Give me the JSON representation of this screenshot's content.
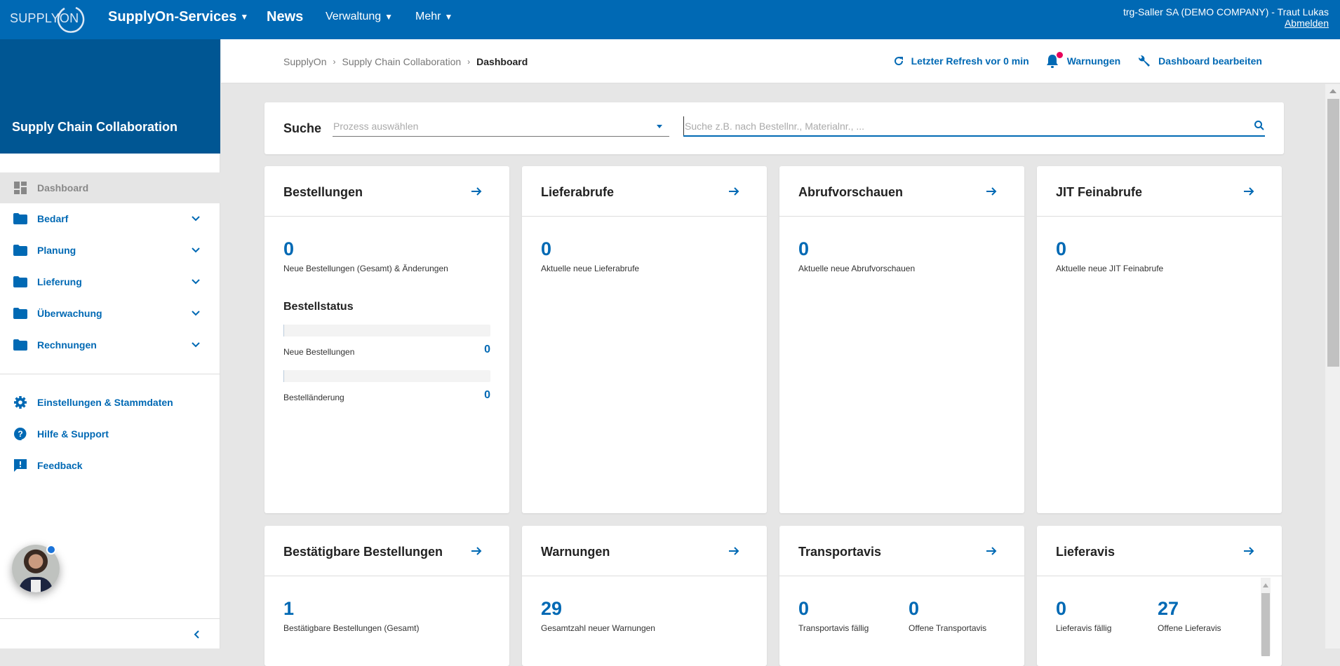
{
  "topbar": {
    "logo_text": "SUPPLYON",
    "nav": [
      {
        "label": "SupplyOn-Services",
        "has_caret": true
      },
      {
        "label": "News",
        "has_caret": false
      },
      {
        "label": "Verwaltung",
        "has_caret": true
      },
      {
        "label": "Mehr",
        "has_caret": true
      }
    ],
    "caret": "▼",
    "user": "trg-Saller SA (DEMO COMPANY) - Traut Lukas",
    "logout": "Abmelden"
  },
  "sidebar": {
    "title": "Supply Chain Collaboration",
    "items": [
      {
        "label": "Dashboard",
        "icon": "dashboard-icon",
        "active": true
      },
      {
        "label": "Bedarf",
        "icon": "folder-icon",
        "expandable": true
      },
      {
        "label": "Planung",
        "icon": "folder-icon",
        "expandable": true
      },
      {
        "label": "Lieferung",
        "icon": "folder-icon",
        "expandable": true
      },
      {
        "label": "Überwachung",
        "icon": "folder-icon",
        "expandable": true
      },
      {
        "label": "Rechnungen",
        "icon": "folder-icon",
        "expandable": true
      }
    ],
    "bottom_items": [
      {
        "label": "Einstellungen & Stammdaten",
        "icon": "gear-icon"
      },
      {
        "label": "Hilfe & Support",
        "icon": "help-icon"
      },
      {
        "label": "Feedback",
        "icon": "feedback-icon"
      }
    ]
  },
  "breadcrumb": {
    "items": [
      "SupplyOn",
      "Supply Chain Collaboration"
    ],
    "current": "Dashboard",
    "separator": "›"
  },
  "header_actions": {
    "refresh": "Letzter Refresh vor 0 min",
    "warnings": "Warnungen",
    "edit_dashboard": "Dashboard bearbeiten"
  },
  "search": {
    "label": "Suche",
    "process_placeholder": "Prozess auswählen",
    "query_placeholder": "Suche z.B. nach Bestellnr., Materialnr., ...",
    "query_value": ""
  },
  "tiles": {
    "bestellungen": {
      "title": "Bestellungen",
      "value": "0",
      "label": "Neue Bestellungen (Gesamt) & Änderungen",
      "status_title": "Bestellstatus",
      "status": [
        {
          "label": "Neue Bestellungen",
          "value": "0",
          "fraction": 0
        },
        {
          "label": "Bestelländerung",
          "value": "0",
          "fraction": 0
        }
      ]
    },
    "lieferabrufe": {
      "title": "Lieferabrufe",
      "value": "0",
      "label": "Aktuelle neue Lieferabrufe"
    },
    "abrufvorschauen": {
      "title": "Abrufvorschauen",
      "value": "0",
      "label": "Aktuelle neue Abrufvorschauen"
    },
    "jit": {
      "title": "JIT Feinabrufe",
      "value": "0",
      "label": "Aktuelle neue JIT Feinabrufe"
    },
    "bestaetigbare": {
      "title": "Bestätigbare Bestellungen",
      "value": "1",
      "label": "Bestätigbare Bestellungen (Gesamt)"
    },
    "warnungen": {
      "title": "Warnungen",
      "value": "29",
      "label": "Gesamtzahl neuer Warnungen"
    },
    "transportavis": {
      "title": "Transportavis",
      "kpis": [
        {
          "value": "0",
          "label": "Transportavis fällig"
        },
        {
          "value": "0",
          "label": "Offene Transportavis"
        }
      ]
    },
    "lieferavis": {
      "title": "Lieferavis",
      "kpis": [
        {
          "value": "0",
          "label": "Lieferavis fällig"
        },
        {
          "value": "27",
          "label": "Offene Lieferavis"
        }
      ]
    }
  },
  "colors": {
    "brand": "#0069b4",
    "sidebar_header": "#005693",
    "notification": "#e8005a"
  }
}
